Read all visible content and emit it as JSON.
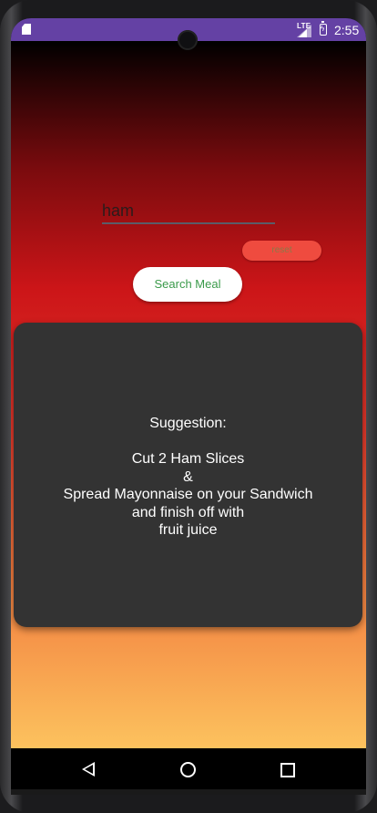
{
  "status_bar": {
    "network": "LTE",
    "time": "2:55",
    "icons": [
      "sd-card-icon",
      "lte-signal-icon",
      "battery-charging-icon"
    ]
  },
  "search": {
    "input_value": "ham"
  },
  "buttons": {
    "reset_label": "reset",
    "search_label": "Search Meal"
  },
  "suggestion": {
    "lines": [
      "Suggestion:",
      "",
      "Cut 2 Ham Slices",
      "&",
      "Spread Mayonnaise on your Sandwich",
      "and finish off with",
      "fruit juice"
    ]
  },
  "colors": {
    "status_bar": "#6441a4",
    "card": "#333333",
    "reset_button": "#ef4b3f",
    "search_text": "#3a9a4a"
  }
}
